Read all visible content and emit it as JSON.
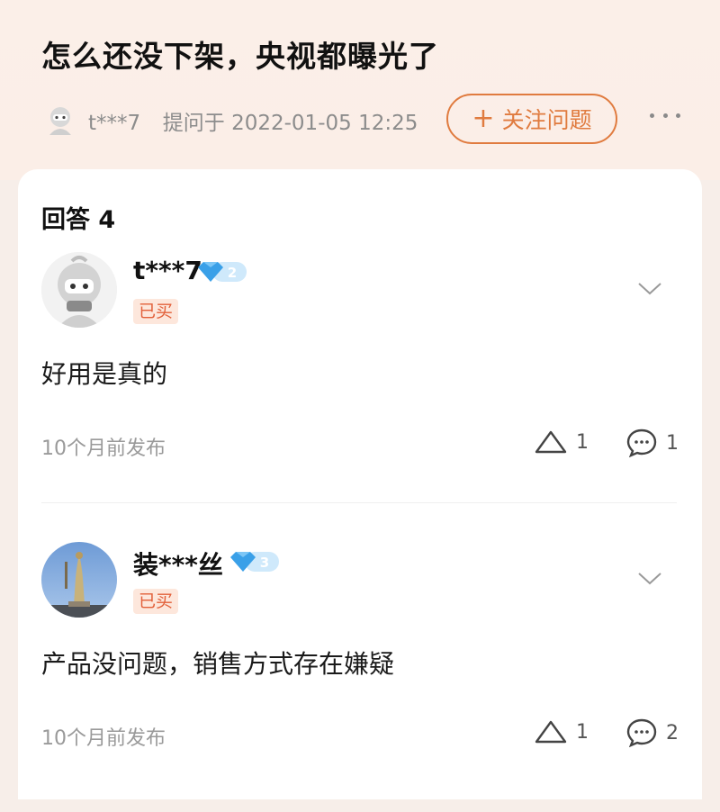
{
  "question": {
    "title": "怎么还没下架，央视都曝光了",
    "asker": "t***7",
    "asked_label": "提问于",
    "asked_time": "2022-01-05 12:25",
    "follow_button": "关注问题",
    "follow_icon": "+"
  },
  "answers_header": "回答 4",
  "answers": [
    {
      "username": "t***7",
      "level": "2",
      "tag": "已买",
      "content": "好用是真的",
      "time": "10个月前发布",
      "likes": "1",
      "comments": "1"
    },
    {
      "username": "装***丝",
      "level": "3",
      "tag": "已买",
      "content": "产品没问题，销售方式存在嫌疑",
      "time": "10个月前发布",
      "likes": "1",
      "comments": "2"
    }
  ],
  "colors": {
    "accent": "#e07b3f",
    "tag_bg": "#fde7dc",
    "tag_text": "#e2603a",
    "header_bg": "#fbefe8"
  }
}
